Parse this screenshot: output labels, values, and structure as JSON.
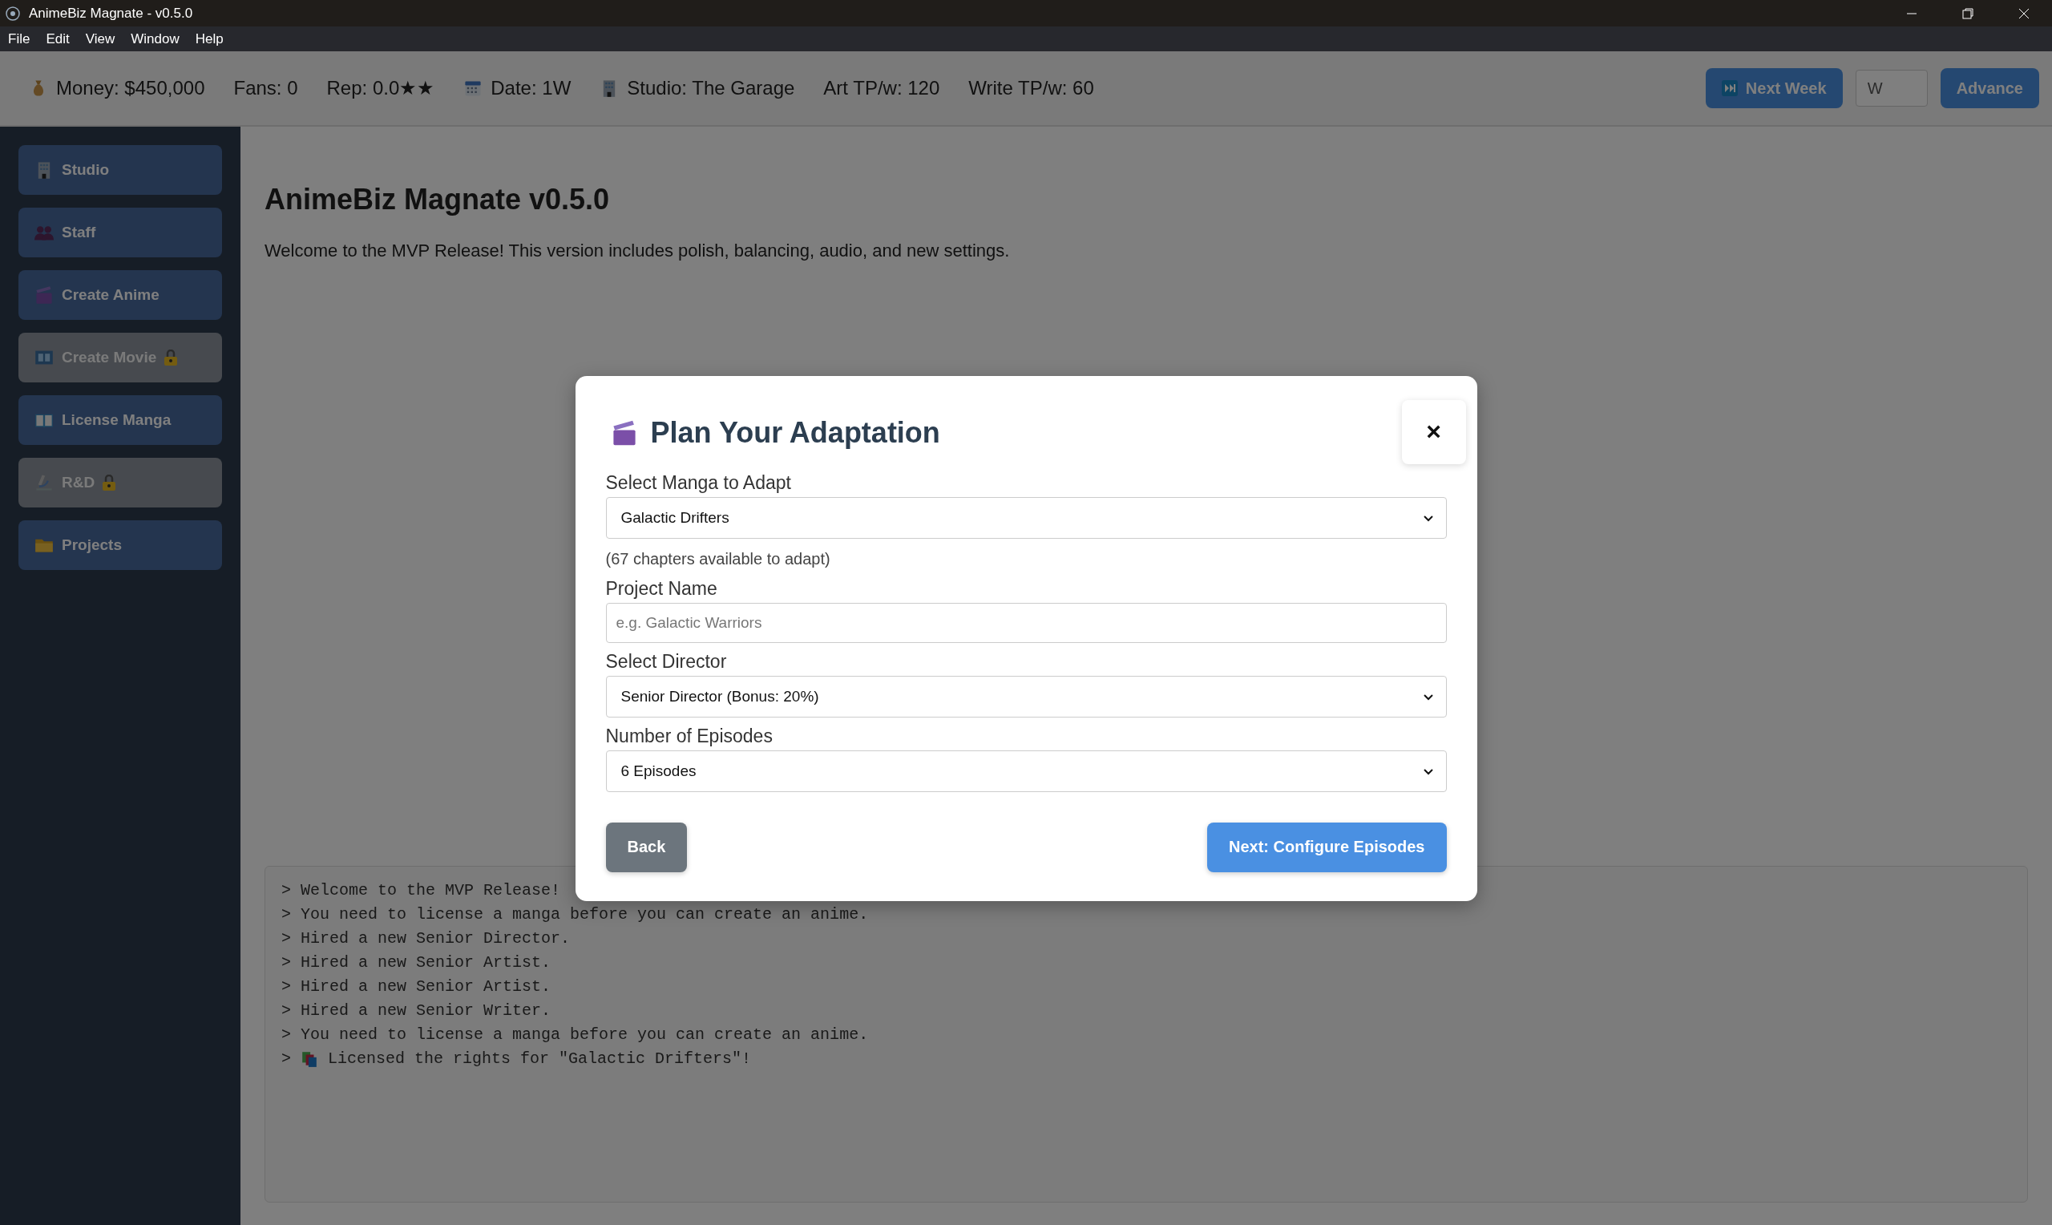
{
  "window": {
    "title": "AnimeBiz Magnate - v0.5.0"
  },
  "menu": [
    "File",
    "Edit",
    "View",
    "Window",
    "Help"
  ],
  "stats": [
    {
      "kind": "money",
      "text": "Money: $450,000"
    },
    {
      "kind": "plain",
      "text": "Fans: 0"
    },
    {
      "kind": "plain",
      "text": "Rep: 0.0★★"
    },
    {
      "kind": "calendar",
      "text": "Date: 1W"
    },
    {
      "kind": "building",
      "text": "Studio: The Garage"
    },
    {
      "kind": "plain",
      "text": "Art TP/w: 120"
    },
    {
      "kind": "plain",
      "text": "Write TP/w: 60"
    }
  ],
  "time_controls": {
    "next_week": "Next Week",
    "weeks_field": {
      "placeholder": "W"
    },
    "advance": "Advance"
  },
  "sidebar": {
    "items": [
      {
        "label": "Studio",
        "locked": false
      },
      {
        "label": "Staff",
        "locked": false
      },
      {
        "label": "Create Anime",
        "locked": false
      },
      {
        "label": "Create Movie",
        "locked": true
      },
      {
        "label": "License Manga",
        "locked": false
      },
      {
        "label": "R&D",
        "locked": true
      },
      {
        "label": "Projects",
        "locked": false
      }
    ]
  },
  "main": {
    "heading": "AnimeBiz Magnate v0.5.0",
    "intro": "Welcome to the MVP Release! This version includes polish, balancing, audio, and new settings."
  },
  "log": [
    {
      "text": "Welcome to the MVP Release!",
      "kind": "plain"
    },
    {
      "text": "You need to license a manga before you can create an anime.",
      "kind": "plain"
    },
    {
      "text": "Hired a new Senior Director.",
      "kind": "plain"
    },
    {
      "text": "Hired a new Senior Artist.",
      "kind": "plain"
    },
    {
      "text": "Hired a new Senior Artist.",
      "kind": "plain"
    },
    {
      "text": "Hired a new Senior Writer.",
      "kind": "plain"
    },
    {
      "text": "You need to license a manga before you can create an anime.",
      "kind": "plain"
    },
    {
      "text": "Licensed the rights for \"Galactic Drifters\"!",
      "kind": "license"
    }
  ],
  "log_prompt": ">",
  "modal": {
    "title": "Plan Your Adaptation",
    "close": "×",
    "fields": [
      {
        "kind": "select",
        "label": "Select Manga to Adapt",
        "value": "Galactic Drifters",
        "hint": "(67 chapters available to adapt)"
      },
      {
        "kind": "input",
        "label": "Project Name",
        "placeholder": "e.g. Galactic Warriors"
      },
      {
        "kind": "select",
        "label": "Select Director",
        "value": "Senior Director (Bonus: 20%)"
      },
      {
        "kind": "select",
        "label": "Number of Episodes",
        "value": "6 Episodes"
      }
    ],
    "back": "Back",
    "next": "Next: Configure Episodes"
  }
}
